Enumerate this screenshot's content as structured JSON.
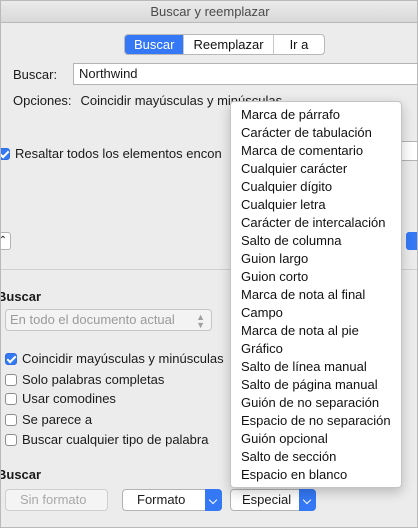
{
  "window": {
    "title": "Buscar y reemplazar"
  },
  "tabs": [
    {
      "label": "Buscar",
      "active": true
    },
    {
      "label": "Reemplazar",
      "active": false
    },
    {
      "label": "Ir a",
      "active": false
    }
  ],
  "search": {
    "label": "Buscar:",
    "value": "Northwind"
  },
  "options": {
    "label": "Opciones:",
    "value": "Coincidir mayúsculas y minúsculas"
  },
  "highlight": {
    "label": "Resaltar todos los elementos encon",
    "checked": true
  },
  "search_section": {
    "heading": "Buscar",
    "scope": {
      "value": "En todo el documento actual"
    },
    "checkboxes": [
      {
        "label": "Coincidir mayúsculas y minúsculas",
        "checked": true
      },
      {
        "label": "Solo palabras completas",
        "checked": false
      },
      {
        "label": "Usar comodines",
        "checked": false
      },
      {
        "label": "Se parece a",
        "checked": false
      },
      {
        "label": "Buscar cualquier tipo de palabra",
        "checked": false
      }
    ]
  },
  "find_section": {
    "heading": "Buscar",
    "buttons": {
      "no_format": "Sin formato",
      "format": "Formato",
      "special": "Especial"
    }
  },
  "special_menu": {
    "items": [
      "Marca de párrafo",
      "Carácter de tabulación",
      "Marca de comentario",
      "Cualquier carácter",
      "Cualquier dígito",
      "Cualquier letra",
      "Carácter de intercalación",
      "Salto de columna",
      "Guion largo",
      "Guion corto",
      "Marca de nota al final",
      "Campo",
      "Marca de nota al pie",
      "Gráfico",
      "Salto de línea manual",
      "Salto de página manual",
      "Guión de no separación",
      "Espacio de no separación",
      "Guión opcional",
      "Salto de sección",
      "Espacio en blanco"
    ]
  },
  "colors": {
    "accent": "#3478f6"
  }
}
